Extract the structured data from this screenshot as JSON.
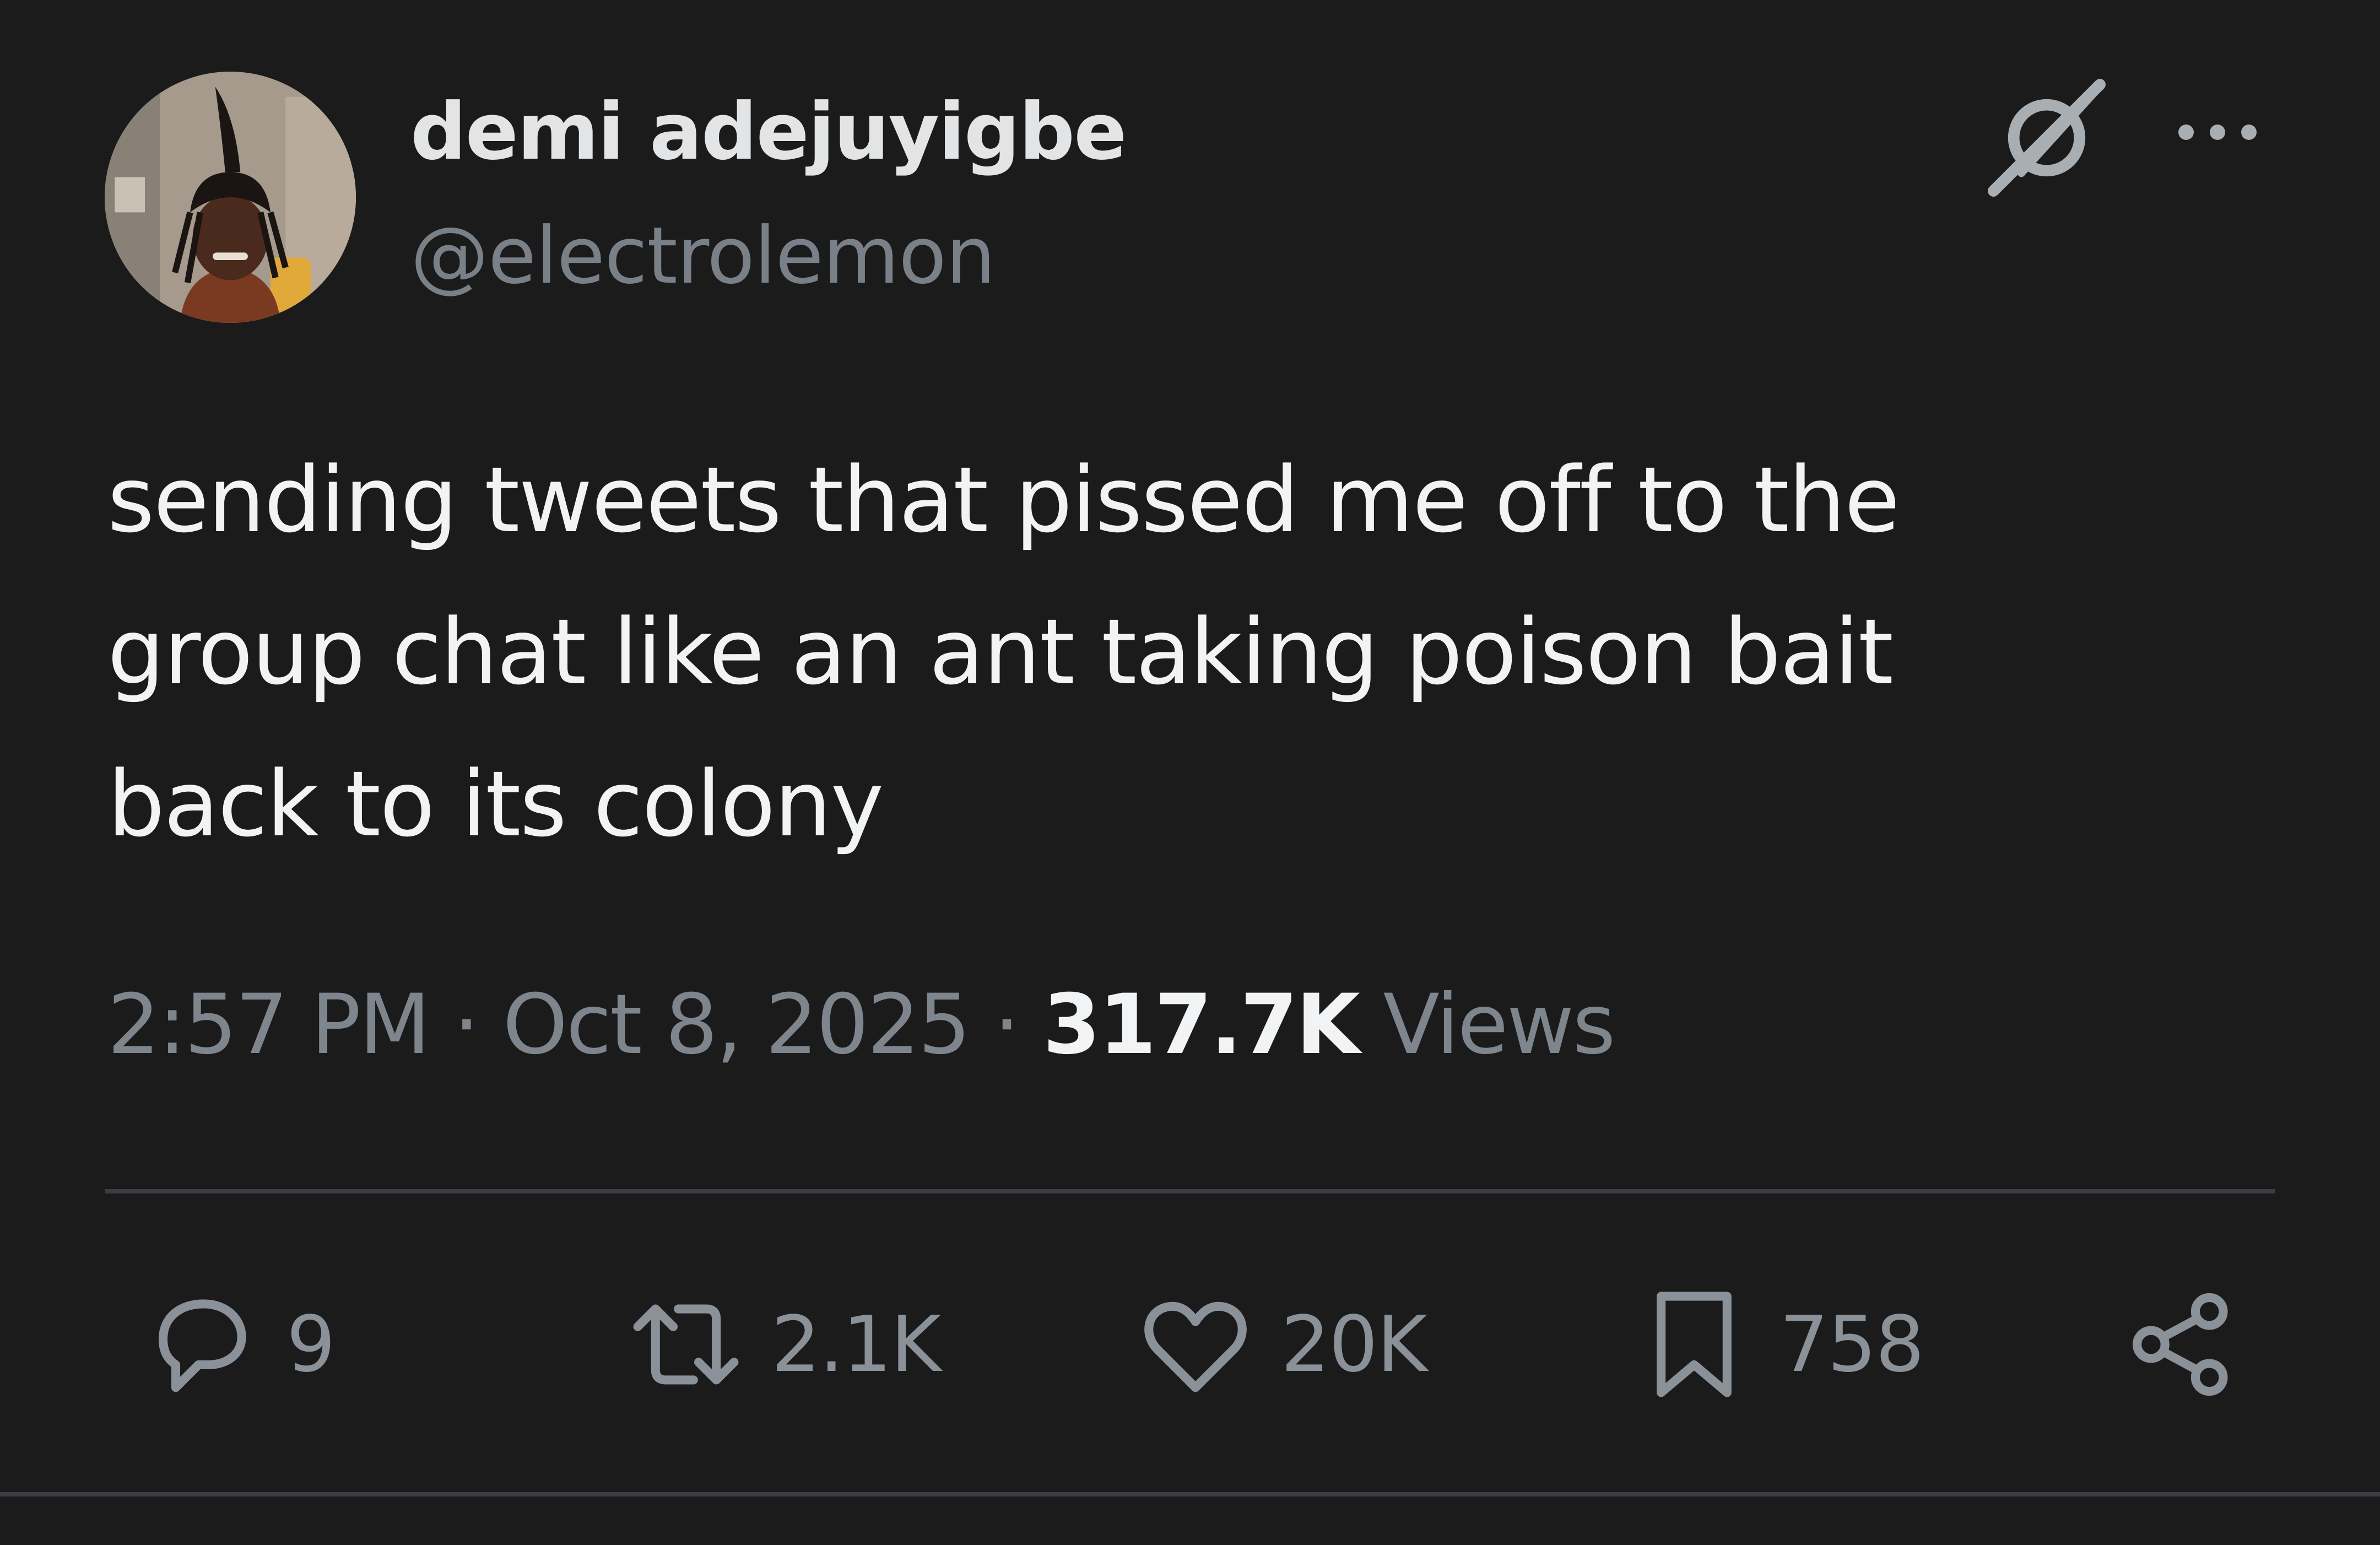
{
  "author": {
    "display_name": "demi adejuyigbe",
    "handle": "@electrolemon",
    "avatar_icon": "profile-photo"
  },
  "header_icons": {
    "grok": "grok-icon",
    "more": "more-options-icon"
  },
  "tweet": {
    "text_lines": [
      "sending tweets that pissed me off to the",
      "group chat like an ant taking poison bait",
      "back to its colony"
    ]
  },
  "meta": {
    "time": "2:57 PM",
    "separator": " · ",
    "date": "Oct 8, 2025",
    "views_count": "317.7K",
    "views_label": " Views"
  },
  "actions": {
    "reply_count": "9",
    "retweet_count": "2.1K",
    "like_count": "20K",
    "bookmark_count": "758"
  },
  "colors": {
    "background": "#1b1b1b",
    "primary_text": "#f2f3f4",
    "secondary_text": "#7e858d",
    "icon": "#8b9198",
    "divider": "#3a3d41"
  }
}
